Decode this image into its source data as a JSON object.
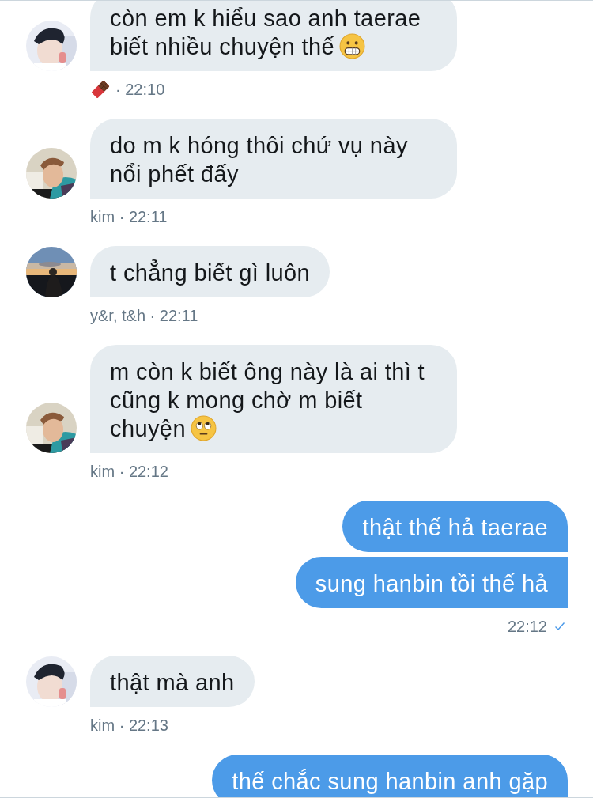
{
  "messages": [
    {
      "kind": "incoming",
      "bubbles": [
        {
          "kind": "grimace-emoji",
          "text": "còn em k hiểu sao anh taerae biết nhiều chuyện thế"
        }
      ],
      "meta": {
        "kind": "chocolate-icon",
        "text": "· 22:10"
      }
    },
    {
      "kind": "incoming",
      "bubbles": [
        {
          "kind": "plain",
          "text": "do m k hóng thôi chứ vụ này nổi phết đấy"
        }
      ],
      "meta": {
        "kind": "plain",
        "text": "kim · 22:11"
      }
    },
    {
      "kind": "incoming",
      "bubbles": [
        {
          "kind": "plain",
          "text": "t chẳng biết gì luôn"
        }
      ],
      "meta": {
        "kind": "plain",
        "text": "y&r, t&h · 22:11"
      }
    },
    {
      "kind": "incoming",
      "bubbles": [
        {
          "kind": "eye-roll-emoji",
          "text": "m còn k biết ông này là ai thì t cũng k mong chờ m biết chuyện"
        }
      ],
      "meta": {
        "kind": "plain",
        "text": "kim · 22:12"
      }
    },
    {
      "kind": "outgoing",
      "bubbles": [
        {
          "kind": "plain",
          "text": "thật thế hả taerae"
        },
        {
          "kind": "plain",
          "text": "sung hanbin tồi thế hả"
        }
      ],
      "meta": {
        "kind": "plain",
        "text": "22:12"
      },
      "read": true
    },
    {
      "kind": "incoming",
      "bubbles": [
        {
          "kind": "plain",
          "text": "thật mà anh"
        }
      ],
      "meta": {
        "kind": "plain",
        "text": "kim · 22:13"
      }
    },
    {
      "kind": "outgoing",
      "bubbles": [
        {
          "kind": "plain",
          "text": "thế chắc sung hanbin anh gặp"
        }
      ]
    }
  ]
}
